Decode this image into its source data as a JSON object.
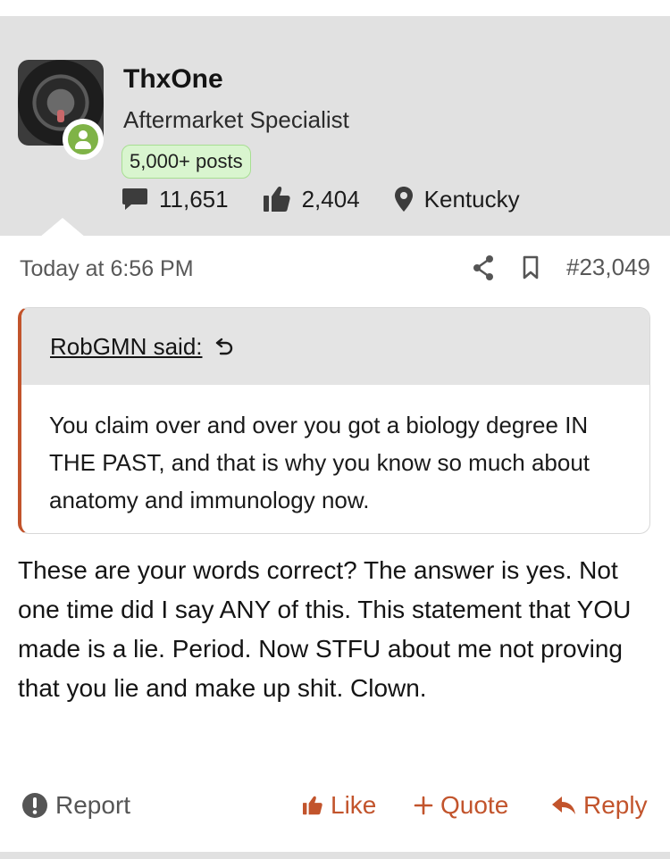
{
  "user": {
    "username": "ThxOne",
    "title": "Aftermarket Specialist",
    "posts_badge": "5,000+ posts",
    "messages": "11,651",
    "reactions": "2,404",
    "location": "Kentucky",
    "avatar_icon": "subwoofer-avatar",
    "online_icon": "user-online-icon"
  },
  "post": {
    "timestamp": "Today at 6:56 PM",
    "post_number": "#23,049",
    "quote": {
      "author_label": "RobGMN said:",
      "text": "You claim over and over you got a biology degree IN THE PAST, and that is why you know so much about anatomy and immunology now."
    },
    "body": "These are your words correct? The answer is yes. Not one time did I say ANY of this. This statement that YOU made is a lie. Period. Now STFU about me not proving that you lie and make up shit. Clown."
  },
  "actions": {
    "report": "Report",
    "like": "Like",
    "quote": "Quote",
    "reply": "Reply"
  },
  "colors": {
    "accent": "#c2542c",
    "panel_bg": "#e1e1e1",
    "badge_bg": "#d9f5cf",
    "online": "#7fb347"
  }
}
